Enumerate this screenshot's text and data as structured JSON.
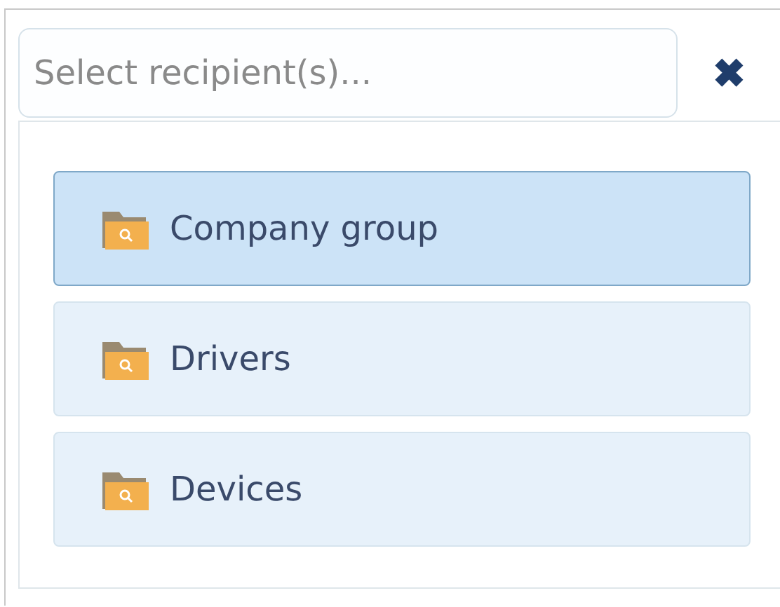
{
  "search": {
    "placeholder": "Select recipient(s)..."
  },
  "close_button": {
    "symbol": "✖"
  },
  "groups": [
    {
      "label": "Company group",
      "selected": true
    },
    {
      "label": "Drivers",
      "selected": false
    },
    {
      "label": "Devices",
      "selected": false
    }
  ]
}
